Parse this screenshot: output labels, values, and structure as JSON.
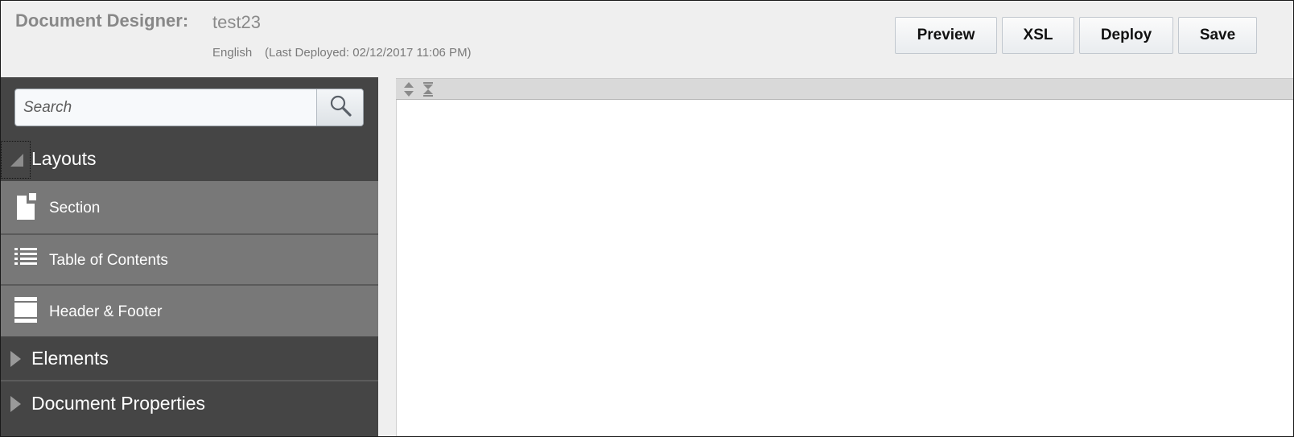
{
  "header": {
    "designer_label": "Document Designer:",
    "document_name": "test23",
    "language": "English",
    "last_deployed": "(Last Deployed: 02/12/2017 11:06 PM)"
  },
  "toolbar": {
    "preview_label": "Preview",
    "xsl_label": "XSL",
    "deploy_label": "Deploy",
    "save_label": "Save"
  },
  "search": {
    "placeholder": "Search",
    "value": "",
    "icon": "search-icon"
  },
  "sidebar": {
    "sections": [
      {
        "label": "Layouts",
        "expanded": true,
        "items": [
          {
            "label": "Section",
            "icon": "section-page-icon"
          },
          {
            "label": "Table of Contents",
            "icon": "list-icon"
          },
          {
            "label": "Header & Footer",
            "icon": "header-footer-icon"
          }
        ]
      },
      {
        "label": "Elements",
        "expanded": false
      },
      {
        "label": "Document Properties",
        "expanded": false
      }
    ]
  },
  "canvas_toolbar": {
    "icons": [
      "expand-collapse-icon",
      "collapse-all-icon"
    ]
  },
  "colors": {
    "sidebar_header": "#454545",
    "sidebar_item": "#787878",
    "header_bg": "#efefef",
    "canvas_bg": "#ffffff"
  }
}
